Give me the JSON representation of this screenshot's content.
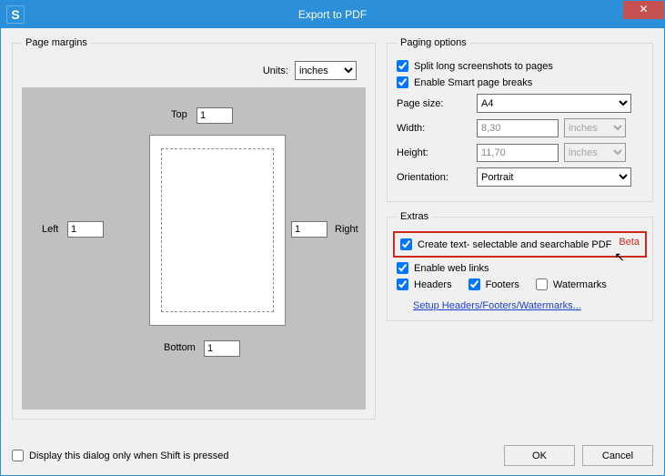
{
  "window": {
    "title": "Export to PDF",
    "app_icon_letter": "S",
    "close_glyph": "✕"
  },
  "margins": {
    "legend": "Page margins",
    "units_label": "Units:",
    "units_value": "inches",
    "top_label": "Top",
    "top_value": "1",
    "left_label": "Left",
    "left_value": "1",
    "right_label": "Right",
    "right_value": "1",
    "bottom_label": "Bottom",
    "bottom_value": "1"
  },
  "paging": {
    "legend": "Paging options",
    "split_label": "Split long screenshots to pages",
    "smart_label": "Enable Smart page breaks",
    "page_size_label": "Page size:",
    "page_size_value": "A4",
    "width_label": "Width:",
    "width_value": "8,30",
    "width_unit": "inches",
    "height_label": "Height:",
    "height_value": "11,70",
    "height_unit": "inches",
    "orientation_label": "Orientation:",
    "orientation_value": "Portrait"
  },
  "extras": {
    "legend": "Extras",
    "searchable_label": "Create text- selectable and searchable PDF",
    "beta_label": "Beta",
    "weblinks_label": "Enable web links",
    "headers_label": "Headers",
    "footers_label": "Footers",
    "watermarks_label": "Watermarks",
    "setup_link": "Setup Headers/Footers/Watermarks..."
  },
  "footer": {
    "shift_label": "Display this dialog only when Shift is pressed",
    "ok_label": "OK",
    "cancel_label": "Cancel"
  }
}
